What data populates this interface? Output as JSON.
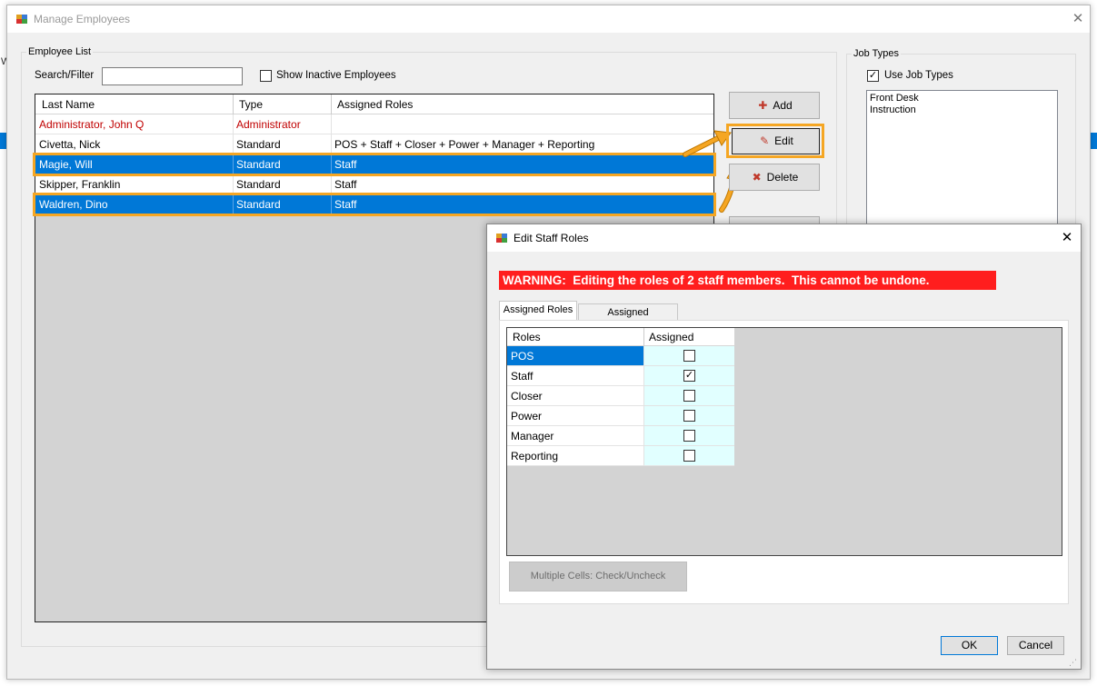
{
  "main_window": {
    "title": "Manage Employees",
    "employee_list": {
      "group_label": "Employee List",
      "search_label": "Search/Filter",
      "search_value": "",
      "show_inactive_label": "Show Inactive Employees",
      "show_inactive_checked": false,
      "columns": [
        "Last Name",
        "Type",
        "Assigned Roles"
      ],
      "rows": [
        {
          "name": "Administrator, John Q",
          "type": "Administrator",
          "roles": "",
          "selected": false,
          "style": "admin"
        },
        {
          "name": "Civetta, Nick",
          "type": "Standard",
          "roles": "POS + Staff + Closer + Power + Manager + Reporting",
          "selected": false,
          "style": "normal"
        },
        {
          "name": "Magie, Will",
          "type": "Standard",
          "roles": "Staff",
          "selected": true,
          "style": "normal"
        },
        {
          "name": "Skipper, Franklin",
          "type": "Standard",
          "roles": "Staff",
          "selected": false,
          "style": "normal"
        },
        {
          "name": "Waldren, Dino",
          "type": "Standard",
          "roles": "Staff",
          "selected": true,
          "style": "normal"
        }
      ]
    },
    "buttons": {
      "add": "Add",
      "edit": "Edit",
      "delete": "Delete"
    },
    "job_types": {
      "group_label": "Job Types",
      "use_label": "Use Job Types",
      "use_checked": true,
      "items": [
        "Front Desk",
        "Instruction"
      ]
    }
  },
  "dialog": {
    "title": "Edit Staff Roles",
    "warning": "WARNING:  Editing the roles of 2 staff members.  This cannot be undone.",
    "tabs": [
      "Assigned Roles",
      "Assigned Permissions"
    ],
    "active_tab": 0,
    "columns": [
      "Roles",
      "Assigned"
    ],
    "roles": [
      {
        "name": "POS",
        "assigned": false,
        "selected": true
      },
      {
        "name": "Staff",
        "assigned": true,
        "selected": false
      },
      {
        "name": "Closer",
        "assigned": false,
        "selected": false
      },
      {
        "name": "Power",
        "assigned": false,
        "selected": false
      },
      {
        "name": "Manager",
        "assigned": false,
        "selected": false
      },
      {
        "name": "Reporting",
        "assigned": false,
        "selected": false
      }
    ],
    "multi_button": "Multiple Cells:  Check/Uncheck",
    "ok": "OK",
    "cancel": "Cancel"
  },
  "colors": {
    "selection": "#0078d7",
    "highlight": "#f5a623",
    "warning_bg": "#ff1e1e",
    "admin_text": "#c00000",
    "assigned_cell": "#e1ffff"
  },
  "icons": [
    "app-icon",
    "close-icon",
    "add-user-icon",
    "edit-user-icon",
    "delete-user-icon",
    "checkbox-icon",
    "resize-grip-icon"
  ]
}
